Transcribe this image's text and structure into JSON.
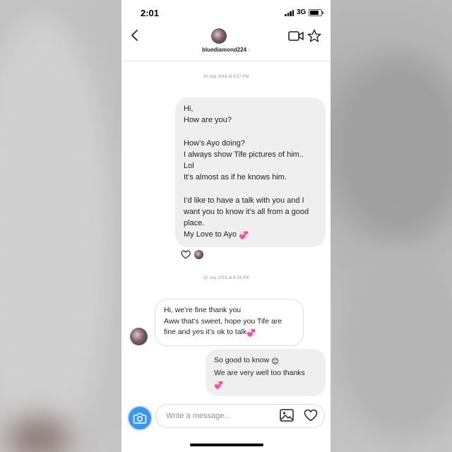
{
  "status_bar": {
    "time": "2:01",
    "network": "3G"
  },
  "header": {
    "username": "bluediamond224"
  },
  "messages": [
    {
      "timestamp": "10 July 2018 at 4:57 PM"
    },
    {
      "direction": "outgoing",
      "text": "Hi,\nHow are you?\n\nHow’s Ayo doing?\nI always show Tife pictures of him..\nLol\nIt’s almost as if he knows him.\n\nI’d like to have a talk with you and I want you to know it’s all from a good place.\nMy Love to Ayo",
      "emoji": "💞"
    },
    {
      "timestamp": "10 July 2018 at 6:16 PM"
    },
    {
      "direction": "incoming",
      "text": "Hi, we’re fine thank you\nAww that’s sweet, hope you Tife are fine and yes it’s ok to talk",
      "emoji": "💞"
    },
    {
      "direction": "outgoing",
      "text_line1": "So good to know",
      "emoji1": "😊",
      "text_line2": "We are very well too thanks",
      "emoji2": "💞"
    }
  ],
  "composer": {
    "placeholder": "Write a message..."
  },
  "colors": {
    "accent": "#3897f0",
    "bubble_outgoing": "#efefef",
    "bubble_incoming_border": "#dedede"
  }
}
